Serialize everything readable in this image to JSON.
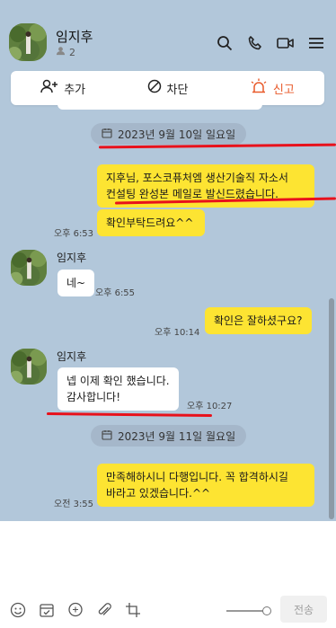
{
  "window": {
    "minimize": "—",
    "maximize": "☐",
    "close": "✕"
  },
  "header": {
    "name": "임지후",
    "member_count": "2"
  },
  "actionbar": {
    "add": "추가",
    "block": "차단",
    "report": "신고"
  },
  "dates": {
    "first": "2023년 9월 10일 일요일",
    "second": "2023년 9월 11일 월요일"
  },
  "messages": {
    "m1": "지후님, 포스코퓨처엠 생산기술직 자소서\n컨설팅 완성본 메일로 발신드렸습니다.",
    "m2": "확인부탁드려요^^",
    "m2_time": "오후 6:53",
    "m3_sender": "임지후",
    "m3": "네~",
    "m3_time": "오후 6:55",
    "m4": "확인은 잘하셨구요?",
    "m4_time": "오후 10:14",
    "m5_sender": "임지후",
    "m5": "넵 이제 확인 했습니다.\n감사합니다!",
    "m5_time": "오후 10:27",
    "m6": "만족해하시니 다행입니다. 꼭 합격하시길\n바라고 있겠습니다.^^",
    "m6_time": "오전 3:55"
  },
  "input": {
    "send_label": "전송"
  },
  "colors": {
    "chat_bg": "#b2c7da",
    "my_bubble": "#fde432",
    "report": "#e85a2a",
    "annotation": "#e8111b"
  }
}
